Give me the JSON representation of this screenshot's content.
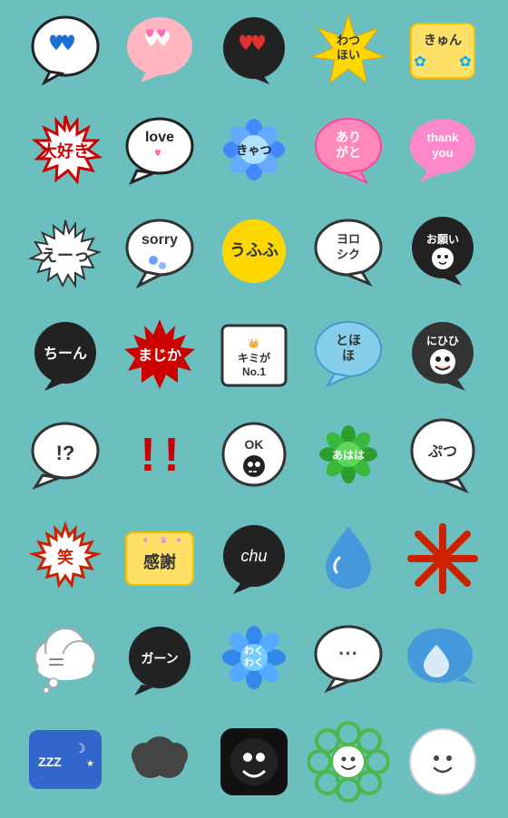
{
  "stickers": [
    {
      "id": 1,
      "label": "blue heart bubble",
      "row": 1,
      "col": 1
    },
    {
      "id": 2,
      "label": "pink heart bubble",
      "row": 1,
      "col": 2
    },
    {
      "id": 3,
      "label": "red heart bubble dark",
      "row": 1,
      "col": 3
    },
    {
      "id": 4,
      "label": "わつほい yellow star",
      "row": 1,
      "col": 4
    },
    {
      "id": 5,
      "label": "きゅん yellow box",
      "row": 1,
      "col": 5
    },
    {
      "id": 6,
      "label": "大好き red outline burst",
      "row": 2,
      "col": 1
    },
    {
      "id": 7,
      "label": "love white bubble",
      "row": 2,
      "col": 2
    },
    {
      "id": 8,
      "label": "きゃつ blue flower",
      "row": 2,
      "col": 3
    },
    {
      "id": 9,
      "label": "ありがとう pink bubble",
      "row": 2,
      "col": 4
    },
    {
      "id": 10,
      "label": "thank you pink bubble",
      "row": 2,
      "col": 5
    },
    {
      "id": 11,
      "label": "えーっ white burst",
      "row": 3,
      "col": 1
    },
    {
      "id": 12,
      "label": "sorry white bubble",
      "row": 3,
      "col": 2
    },
    {
      "id": 13,
      "label": "うふふ yellow bubble",
      "row": 3,
      "col": 3
    },
    {
      "id": 14,
      "label": "ヨロシク white bubble",
      "row": 3,
      "col": 4
    },
    {
      "id": 15,
      "label": "お願い dark bubble",
      "row": 3,
      "col": 5
    },
    {
      "id": 16,
      "label": "ちーん black bubble",
      "row": 4,
      "col": 1
    },
    {
      "id": 17,
      "label": "まじか red burst",
      "row": 4,
      "col": 2
    },
    {
      "id": 18,
      "label": "キミがNo.1 white box",
      "row": 4,
      "col": 3
    },
    {
      "id": 19,
      "label": "とほほ blue bubble",
      "row": 4,
      "col": 4
    },
    {
      "id": 20,
      "label": "にひひ dark face",
      "row": 4,
      "col": 5
    },
    {
      "id": 21,
      "label": "!? white bubble",
      "row": 5,
      "col": 1
    },
    {
      "id": 22,
      "label": "!! red text",
      "row": 5,
      "col": 2
    },
    {
      "id": 23,
      "label": "OK black face",
      "row": 5,
      "col": 3
    },
    {
      "id": 24,
      "label": "あはは green bubble",
      "row": 5,
      "col": 4
    },
    {
      "id": 25,
      "label": "ぷつ white bubble",
      "row": 5,
      "col": 5
    },
    {
      "id": 26,
      "label": "笑 red outline",
      "row": 6,
      "col": 1
    },
    {
      "id": 27,
      "label": "感謝 yellow box",
      "row": 6,
      "col": 2
    },
    {
      "id": 28,
      "label": "chu black bubble",
      "row": 6,
      "col": 3
    },
    {
      "id": 29,
      "label": "water drop",
      "row": 6,
      "col": 4
    },
    {
      "id": 30,
      "label": "asterisk cross",
      "row": 6,
      "col": 5
    },
    {
      "id": 31,
      "label": "cloud speech bubble",
      "row": 7,
      "col": 1
    },
    {
      "id": 32,
      "label": "ガーン black bubble",
      "row": 7,
      "col": 2
    },
    {
      "id": 33,
      "label": "わくわく blue flower",
      "row": 7,
      "col": 3
    },
    {
      "id": 34,
      "label": "... white bubble",
      "row": 7,
      "col": 4
    },
    {
      "id": 35,
      "label": "blue speech bubble",
      "row": 7,
      "col": 5
    },
    {
      "id": 36,
      "label": "ZZZ blue sleep",
      "row": 8,
      "col": 1
    },
    {
      "id": 37,
      "label": "dark cloud ball",
      "row": 8,
      "col": 2
    },
    {
      "id": 38,
      "label": "black face square",
      "row": 8,
      "col": 3
    },
    {
      "id": 39,
      "label": "green flower face",
      "row": 8,
      "col": 4
    },
    {
      "id": 40,
      "label": "white circle smile",
      "row": 8,
      "col": 5
    }
  ]
}
